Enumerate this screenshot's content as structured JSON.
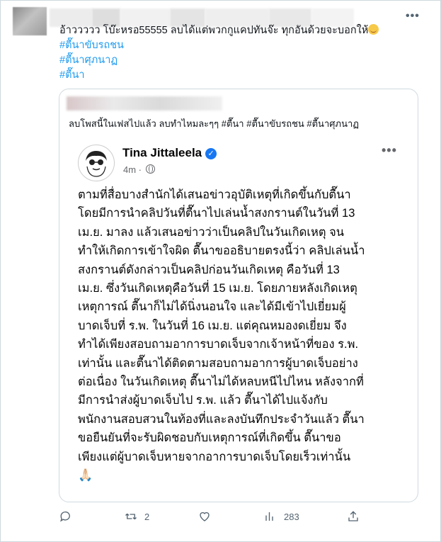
{
  "tweet": {
    "more_icon": "more-horizontal-icon",
    "text_line": "อ้าววววว โบ๊ะหรอ55555 ลบได้แต่พวกกูแคปทันจ๊ะ ทุกอันด้วยจะบอกให้",
    "hashtags": [
      "#ตื๊นาขับรถชน",
      "#ตื๊นาศุภนาฏ",
      "#ตื๊นา"
    ]
  },
  "quote": {
    "caption": "ลบโพสนี้ในเฟสไปแล้ว ลบทำไหมละๆๆ #ตื๊นา  #ตื๊นาขับรถชน #ตื๊นาศุภนาฏ",
    "post": {
      "author": "Tina Jittaleela",
      "time": "4m",
      "body_lines": [
        "ตามที่สื่อบางสำนักได้เสนอข่าวอุบัติเหตุที่เกิดขึ้นกับตื๊นา",
        "โดยมีการนำคลิปวันที่ตื๊นาไปเล่นน้ำสงกรานต์ในวันที่ 13",
        "เม.ย. มาลง แล้วเสนอข่าวว่าเป็นคลิปในวันเกิดเหตุ จน",
        "ทำให้เกิดการเข้าใจผิด ตื๊นาขออธิบายตรงนี้ว่า คลิปเล่นน้ำ",
        "สงกรานต์ดังกล่าวเป็นคลิปก่อนวันเกิดเหตุ คือวันที่ 13",
        "เม.ย. ซึ่งวันเกิดเหตุคือวันที่ 15 เม.ย. โดยภายหลังเกิดเหตุ",
        "เหตุการณ์ ตื๊นาก็ไม่ได้นิ่งนอนใจ และได้มีเข้าไปเยี่ยมผู้",
        "บาดเจ็บที่ ร.พ. ในวันที่ 16 เม.ย. แต่คุณหมองดเยี่ยม จึง",
        "ทำได้เพียงสอบถามอาการบาดเจ็บจากเจ้าหน้าที่ของ ร.พ.",
        "เท่านั้น และตื๊นาได้ติดตามสอบถามอาการผู้บาดเจ็บอย่าง",
        "ต่อเนื่อง ในวันเกิดเหตุ ตื๊นาไม่ได้หลบหนีไปไหน หลังจากที่",
        "มีการนำส่งผู้บาดเจ็บไป ร.พ. แล้ว ตื๊นาได้ไปแจ้งกับ",
        "พนักงานสอบสวนในท้องที่และลงบันทึกประจำวันแล้ว ตื๊นา",
        "ขอยืนยันที่จะรับผิดชอบกับเหตุการณ์ที่เกิดขึ้น ตื๊นาขอ",
        "เพียงแต่ผู้บาดเจ็บหายจากอาการบาดเจ็บโดยเร็วเท่านั้น"
      ],
      "closing_emoji": "🙏🏻"
    }
  },
  "actions": {
    "reply": {
      "icon": "reply-icon",
      "count": ""
    },
    "retweet": {
      "icon": "retweet-icon",
      "count": "2"
    },
    "like": {
      "icon": "heart-icon",
      "count": ""
    },
    "views": {
      "icon": "views-icon",
      "count": "283"
    },
    "share": {
      "icon": "share-icon",
      "count": ""
    }
  },
  "colors": {
    "link": "#1d9bf0",
    "secondary_text": "#536471",
    "border": "#cfd9de",
    "verified": "#1877f2"
  }
}
